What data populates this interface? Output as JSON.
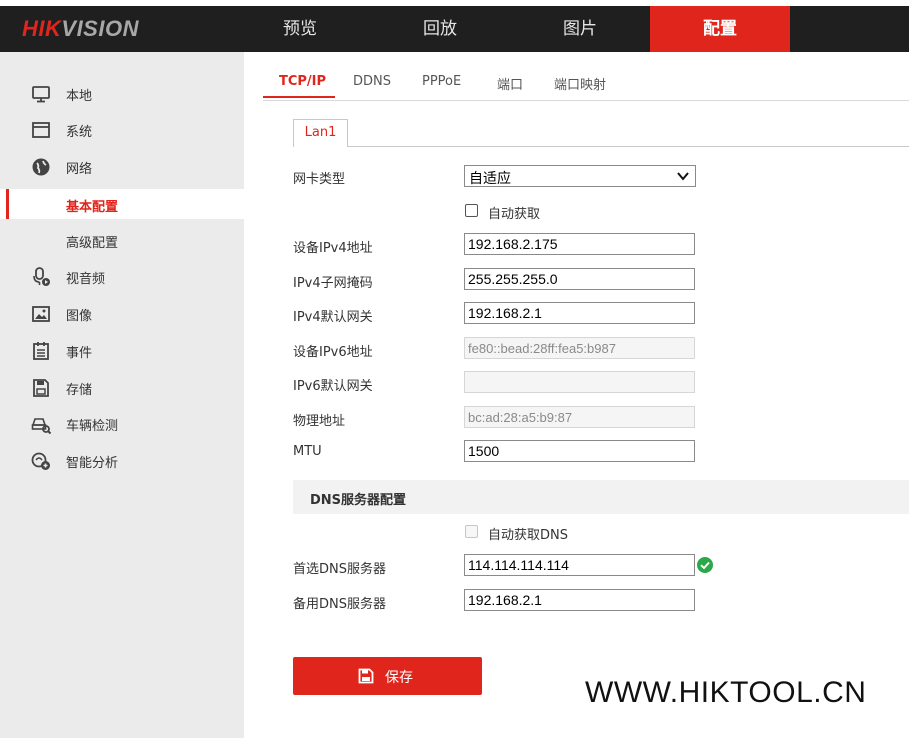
{
  "brand": {
    "logo_red": "HIK",
    "logo_grey": "VISION"
  },
  "nav": {
    "items": [
      {
        "label": "预览"
      },
      {
        "label": "回放"
      },
      {
        "label": "图片"
      },
      {
        "label": "配置"
      }
    ],
    "active_index": 3
  },
  "sidebar": {
    "items": [
      {
        "label": "本地",
        "icon": "monitor-icon"
      },
      {
        "label": "系统",
        "icon": "window-icon"
      },
      {
        "label": "网络",
        "icon": "globe-icon"
      },
      {
        "label": "基本配置",
        "icon": ""
      },
      {
        "label": "高级配置",
        "icon": ""
      },
      {
        "label": "视音频",
        "icon": "microphone-icon"
      },
      {
        "label": "图像",
        "icon": "image-icon"
      },
      {
        "label": "事件",
        "icon": "calendar-icon"
      },
      {
        "label": "存储",
        "icon": "save-icon"
      },
      {
        "label": "车辆检测",
        "icon": "vehicle-search-icon"
      },
      {
        "label": "智能分析",
        "icon": "analytics-icon"
      }
    ],
    "active_label": "基本配置"
  },
  "tabs": {
    "items": [
      "TCP/IP",
      "DDNS",
      "PPPoE",
      "端口",
      "端口映射"
    ],
    "active": "TCP/IP"
  },
  "lan_tab": "Lan1",
  "form": {
    "nic_type": {
      "label": "网卡类型",
      "value": "自适应"
    },
    "auto_obtain": {
      "label": "自动获取",
      "checked": false
    },
    "ipv4_address": {
      "label": "设备IPv4地址",
      "value": "192.168.2.175"
    },
    "ipv4_mask": {
      "label": "IPv4子网掩码",
      "value": "255.255.255.0"
    },
    "ipv4_gateway": {
      "label": "IPv4默认网关",
      "value": "192.168.2.1"
    },
    "ipv6_address": {
      "label": "设备IPv6地址",
      "value": "fe80::bead:28ff:fea5:b987"
    },
    "ipv6_gateway": {
      "label": "IPv6默认网关",
      "value": ""
    },
    "mac_address": {
      "label": "物理地址",
      "value": "bc:ad:28:a5:b9:87"
    },
    "mtu": {
      "label": "MTU",
      "value": "1500"
    }
  },
  "dns": {
    "section_title": "DNS服务器配置",
    "auto_dns": {
      "label": "自动获取DNS",
      "checked": false
    },
    "preferred": {
      "label": "首选DNS服务器",
      "value": "114.114.114.114"
    },
    "alternate": {
      "label": "备用DNS服务器",
      "value": "192.168.2.1"
    }
  },
  "save_button": {
    "label": "保存"
  },
  "watermark": "WWW.HIKTOOL.CN",
  "colors": {
    "accent": "#e0261c",
    "topbar": "#1f1f1f",
    "sidebar": "#ebebeb",
    "ok": "#2aa84a"
  }
}
